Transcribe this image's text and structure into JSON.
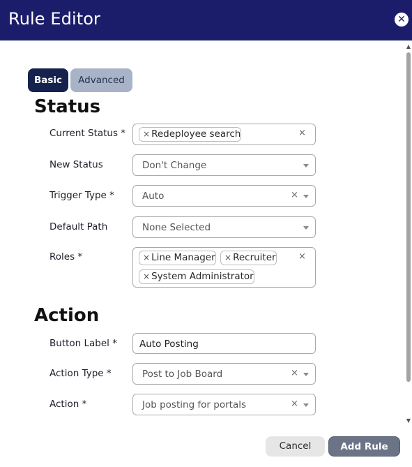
{
  "window": {
    "title": "Rule Editor"
  },
  "tabs": {
    "basic": "Basic",
    "advanced": "Advanced"
  },
  "sections": {
    "status": "Status",
    "action": "Action"
  },
  "fields": {
    "current_status": {
      "label": "Current Status *",
      "chips": [
        "Redeployee search"
      ]
    },
    "new_status": {
      "label": "New Status",
      "value": "Don't Change"
    },
    "trigger_type": {
      "label": "Trigger Type *",
      "value": "Auto"
    },
    "default_path": {
      "label": "Default Path",
      "value": "None Selected"
    },
    "roles": {
      "label": "Roles *",
      "chips": [
        "Line Manager",
        "Recruiter",
        "System Administrator"
      ]
    },
    "button_label": {
      "label": "Button Label *",
      "value": "Auto Posting"
    },
    "action_type": {
      "label": "Action Type *",
      "value": "Post to Job Board"
    },
    "action": {
      "label": "Action *",
      "value": "Job posting for portals"
    }
  },
  "buttons": {
    "cancel": "Cancel",
    "add_rule": "Add Rule"
  },
  "icons": {
    "close": "close-icon",
    "chip_remove": "x-icon",
    "clear": "clear-icon",
    "dropdown": "chevron-down-icon"
  },
  "colors": {
    "header": "#1b1c6a",
    "tab_active": "#15224d",
    "tab_inactive": "#a9b3c8",
    "primary_button": "#6b7387"
  }
}
